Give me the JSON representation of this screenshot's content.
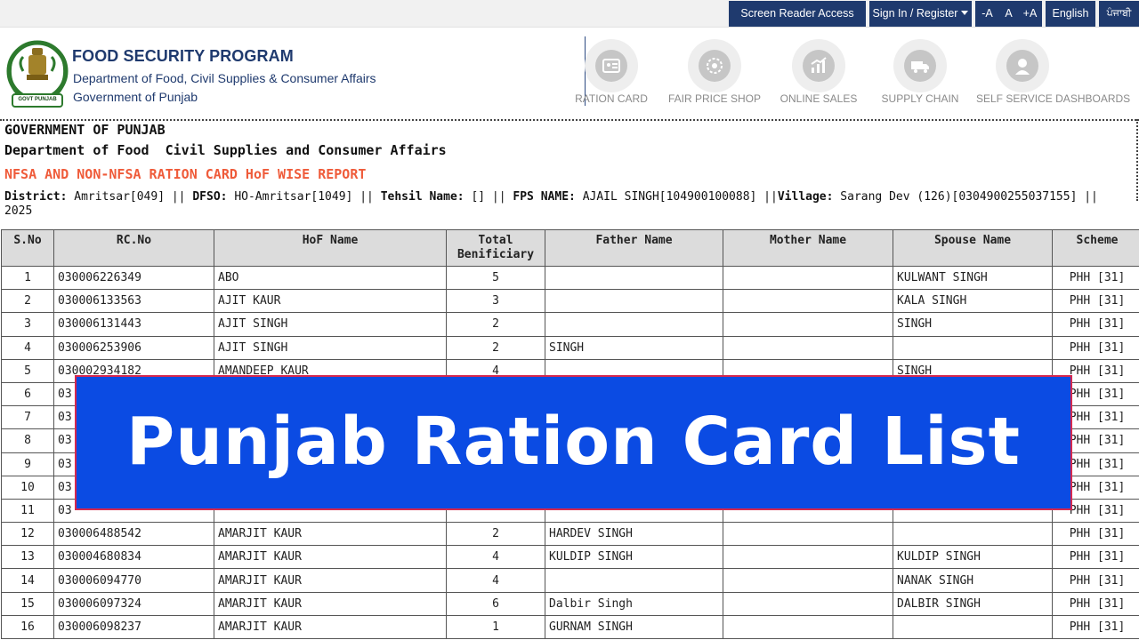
{
  "topbar": {
    "screen_reader": "Screen Reader Access",
    "sign_in": "Sign In / Register",
    "font_minus": "-A",
    "font_normal": "A",
    "font_plus": "+A",
    "lang_english": "English",
    "lang_punjabi": "ਪੰਜਾਬੀ"
  },
  "header": {
    "title": "FOOD SECURITY PROGRAM",
    "dept": "Department of Food, Civil Supplies & Consumer Affairs",
    "govt": "Government of Punjab",
    "emblem_text": "GOVT PUNJAB"
  },
  "nav": {
    "items": [
      {
        "label": "RATION CARD",
        "icon": "ration-card-icon"
      },
      {
        "label": "FAIR PRICE SHOP",
        "icon": "fair-price-shop-icon"
      },
      {
        "label": "ONLINE SALES",
        "icon": "online-sales-icon"
      },
      {
        "label": "SUPPLY CHAIN",
        "icon": "supply-chain-icon"
      },
      {
        "label": "SELF SERVICE DASHBOARDS",
        "icon": "dashboard-icon"
      }
    ]
  },
  "report": {
    "gov": "GOVERNMENT OF PUNJAB",
    "dept": "Department of Food  Civil Supplies and Consumer Affairs",
    "title": "NFSA AND NON-NFSA RATION CARD HoF WISE REPORT",
    "district_label": "District:",
    "district": "Amritsar[049]",
    "dfso_label": "DFSO:",
    "dfso": "HO-Amritsar[1049]",
    "tehsil_label": "Tehsil Name:",
    "tehsil": "[]",
    "fps_label": "FPS NAME:",
    "fps": "AJAIL SINGH[104900100088]",
    "village_label": "Village:",
    "village": "Sarang Dev  (126)[0304900255037155]",
    "year": "2025"
  },
  "table": {
    "headers": {
      "sno": "S.No",
      "rcno": "RC.No",
      "hof": "HoF Name",
      "total_line1": "Total",
      "total_line2": "Benificiary",
      "father": "Father Name",
      "mother": "Mother Name",
      "spouse": "Spouse Name",
      "scheme": "Scheme"
    },
    "rows": [
      {
        "sno": "1",
        "rc": "030006226349",
        "hof": "ABO",
        "total": "5",
        "father": "",
        "mother": "",
        "spouse": "KULWANT SINGH",
        "scheme": "PHH [31]"
      },
      {
        "sno": "2",
        "rc": "030006133563",
        "hof": "AJIT KAUR",
        "total": "3",
        "father": "",
        "mother": "",
        "spouse": "KALA SINGH",
        "scheme": "PHH [31]"
      },
      {
        "sno": "3",
        "rc": "030006131443",
        "hof": "AJIT SINGH",
        "total": "2",
        "father": "",
        "mother": "",
        "spouse": "SINGH",
        "scheme": "PHH [31]"
      },
      {
        "sno": "4",
        "rc": "030006253906",
        "hof": "AJIT SINGH",
        "total": "2",
        "father": "SINGH",
        "mother": "",
        "spouse": "",
        "scheme": "PHH [31]"
      },
      {
        "sno": "5",
        "rc": "030002934182",
        "hof": "AMANDEEP KAUR",
        "total": "4",
        "father": "",
        "mother": "",
        "spouse": "SINGH",
        "scheme": "PHH [31]"
      },
      {
        "sno": "6",
        "rc": "03",
        "hof": "",
        "total": "",
        "father": "",
        "mother": "",
        "spouse": "",
        "scheme": "PHH [31]"
      },
      {
        "sno": "7",
        "rc": "03",
        "hof": "",
        "total": "",
        "father": "",
        "mother": "",
        "spouse": "",
        "scheme": "PHH [31]"
      },
      {
        "sno": "8",
        "rc": "03",
        "hof": "",
        "total": "",
        "father": "",
        "mother": "",
        "spouse": "",
        "scheme": "PHH [31]"
      },
      {
        "sno": "9",
        "rc": "03",
        "hof": "",
        "total": "",
        "father": "",
        "mother": "",
        "spouse": "",
        "scheme": "PHH [31]"
      },
      {
        "sno": "10",
        "rc": "03",
        "hof": "",
        "total": "",
        "father": "",
        "mother": "",
        "spouse": "",
        "scheme": "PHH [31]"
      },
      {
        "sno": "11",
        "rc": "03",
        "hof": "",
        "total": "",
        "father": "",
        "mother": "",
        "spouse": "",
        "scheme": "PHH [31]"
      },
      {
        "sno": "12",
        "rc": "030006488542",
        "hof": "AMARJIT KAUR",
        "total": "2",
        "father": "HARDEV SINGH",
        "mother": "",
        "spouse": "",
        "scheme": "PHH [31]"
      },
      {
        "sno": "13",
        "rc": "030004680834",
        "hof": "AMARJIT KAUR",
        "total": "4",
        "father": "KULDIP SINGH",
        "mother": "",
        "spouse": "KULDIP SINGH",
        "scheme": "PHH [31]"
      },
      {
        "sno": "14",
        "rc": "030006094770",
        "hof": "AMARJIT KAUR",
        "total": "4",
        "father": "",
        "mother": "",
        "spouse": "NANAK SINGH",
        "scheme": "PHH [31]"
      },
      {
        "sno": "15",
        "rc": "030006097324",
        "hof": "AMARJIT KAUR",
        "total": "6",
        "father": "Dalbir Singh",
        "mother": "",
        "spouse": "DALBIR SINGH",
        "scheme": "PHH [31]"
      },
      {
        "sno": "16",
        "rc": "030006098237",
        "hof": "AMARJIT KAUR",
        "total": "1",
        "father": "GURNAM SINGH",
        "mother": "",
        "spouse": "",
        "scheme": "PHH [31]"
      }
    ]
  },
  "banner": {
    "text": "Punjab Ration Card List"
  },
  "colors": {
    "navy": "#1f3a6e",
    "banner_blue": "#0b4be3",
    "report_title": "#ef5b3a",
    "table_header_bg": "#dcdcdc"
  }
}
